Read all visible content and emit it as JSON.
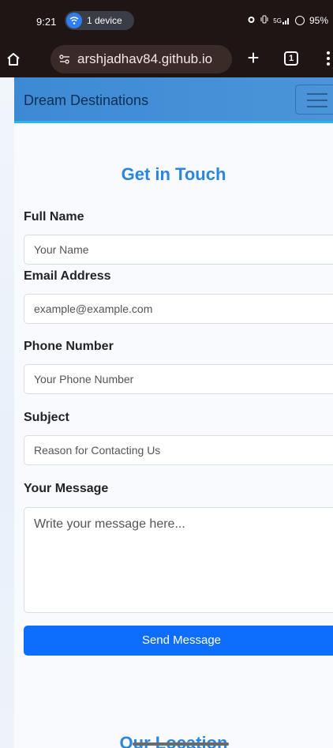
{
  "status_bar": {
    "time": "9:21",
    "device_label": "1 device",
    "icons": [
      "alarm-icon",
      "vibrate-icon",
      "signal-icon",
      "battery-icon"
    ],
    "signal_text": "5G",
    "battery": "95%"
  },
  "browser": {
    "url": "arshjadhav84.github.io",
    "tab_count": "1"
  },
  "navbar": {
    "brand": "Dream Destinations"
  },
  "form": {
    "title": "Get in Touch",
    "full_name": {
      "label": "Full Name",
      "placeholder": "Your Name"
    },
    "email": {
      "label": "Email Address",
      "placeholder": "example@example.com"
    },
    "phone": {
      "label": "Phone Number",
      "placeholder": "Your Phone Number"
    },
    "subject": {
      "label": "Subject",
      "placeholder": "Reason for Contacting Us"
    },
    "message": {
      "label": "Your Message",
      "placeholder": "Write your message here..."
    },
    "submit_label": "Send Message"
  },
  "next_section": {
    "heading": "Our Location"
  },
  "colors": {
    "accent": "#2b86e0",
    "button": "#0d6efd",
    "navbar": "#4b94d9",
    "browser_chrome": "#1e1514"
  }
}
